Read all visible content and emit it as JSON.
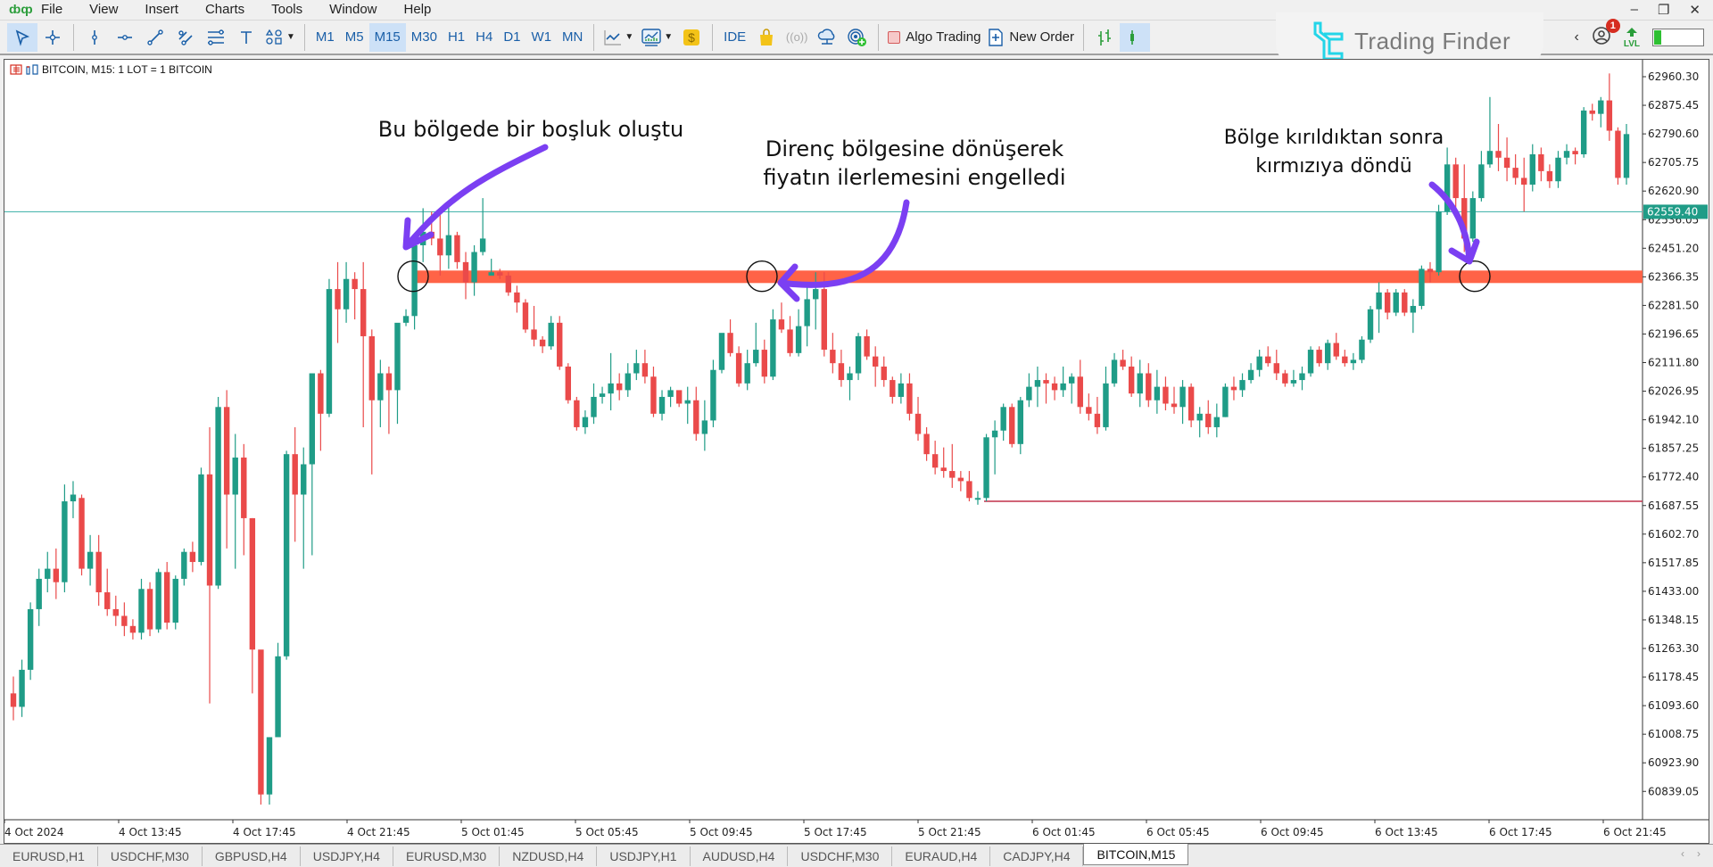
{
  "menu": {
    "items": [
      "File",
      "View",
      "Insert",
      "Charts",
      "Tools",
      "Window",
      "Help"
    ]
  },
  "window_controls": [
    "minimize",
    "restore",
    "close"
  ],
  "toolbar": {
    "drawing_tools": [
      "cursor-icon",
      "crosshair-icon",
      "vertical-line-icon",
      "horizontal-line-icon",
      "trendline-icon",
      "channel-icon",
      "fibonacci-icon",
      "text-icon",
      "shapes-icon"
    ],
    "timeframes": [
      "M1",
      "M5",
      "M15",
      "M30",
      "H1",
      "H4",
      "D1",
      "W1",
      "MN"
    ],
    "active_timeframe": "M15",
    "ide_label": "IDE",
    "algo_trading_label": "Algo Trading",
    "new_order_label": "New Order"
  },
  "brand": {
    "name": "Trading Finder",
    "color": "#23d5e8"
  },
  "notifications": {
    "count": "1"
  },
  "level": {
    "label": "LVL",
    "fill_fraction": 0.15
  },
  "chart": {
    "symbol_info": "BITCOIN, M15:  1 LOT = 1 BITCOIN",
    "current_price_label": "62559.40",
    "colors": {
      "bull": "#1f9c87",
      "bear": "#ea4a4a",
      "zone": "#ff6347",
      "bid_line": "#4fb8b0",
      "support_line": "#c0304a",
      "arrow": "#7b3ff2"
    },
    "annotations": [
      {
        "text": "Bu bölgede bir boşluk oluştu"
      },
      {
        "text_line1": "Direnç bölgesine dönüşerek",
        "text_line2": "fiyatın ilerlemesini engelledi"
      },
      {
        "text_line1": "Bölge kırıldıktan sonra",
        "text_line2": "kırmızıya döndü"
      }
    ]
  },
  "chart_data": {
    "type": "candlestick",
    "title": "BITCOIN, M15",
    "xlabel": "",
    "ylabel": "",
    "y_ticks": [
      "62960.30",
      "62875.45",
      "62790.60",
      "62705.75",
      "62620.90",
      "62536.05",
      "62451.20",
      "62366.35",
      "62281.50",
      "62196.65",
      "62111.80",
      "62026.95",
      "61942.10",
      "61857.25",
      "61772.40",
      "61687.55",
      "61602.70",
      "61517.85",
      "61433.00",
      "61348.15",
      "61263.30",
      "61178.45",
      "61093.60",
      "61008.75",
      "60923.90",
      "60839.05"
    ],
    "ylim": [
      60800,
      63000
    ],
    "x_ticks": [
      "4 Oct 2024",
      "4 Oct 13:45",
      "4 Oct 17:45",
      "4 Oct 21:45",
      "5 Oct 01:45",
      "5 Oct 05:45",
      "5 Oct 09:45",
      "5 Oct 17:45",
      "5 Oct 21:45",
      "6 Oct 01:45",
      "6 Oct 05:45",
      "6 Oct 09:45",
      "6 Oct 13:45",
      "6 Oct 17:45",
      "6 Oct 21:45"
    ],
    "current_price": 62559.4,
    "resistance_zone": [
      62350,
      62385
    ],
    "support_line": 61700,
    "ohlc": [
      [
        61130,
        61180,
        61050,
        61090
      ],
      [
        61090,
        61230,
        61060,
        61200
      ],
      [
        61200,
        61400,
        61170,
        61380
      ],
      [
        61380,
        61500,
        61330,
        61470
      ],
      [
        61470,
        61550,
        61430,
        61500
      ],
      [
        61500,
        61560,
        61410,
        61460
      ],
      [
        61460,
        61750,
        61430,
        61700
      ],
      [
        61700,
        61760,
        61650,
        61720
      ],
      [
        61710,
        61720,
        61480,
        61500
      ],
      [
        61500,
        61600,
        61450,
        61550
      ],
      [
        61550,
        61600,
        61390,
        61430
      ],
      [
        61430,
        61500,
        61360,
        61380
      ],
      [
        61380,
        61420,
        61330,
        61360
      ],
      [
        61360,
        61400,
        61300,
        61330
      ],
      [
        61330,
        61350,
        61290,
        61310
      ],
      [
        61310,
        61470,
        61290,
        61440
      ],
      [
        61440,
        61460,
        61300,
        61320
      ],
      [
        61320,
        61500,
        61310,
        61490
      ],
      [
        61490,
        61520,
        61320,
        61340
      ],
      [
        61340,
        61480,
        61320,
        61470
      ],
      [
        61470,
        61560,
        61450,
        61550
      ],
      [
        61550,
        61580,
        61490,
        61520
      ],
      [
        61520,
        61800,
        61510,
        61780
      ],
      [
        61780,
        61920,
        61100,
        61450
      ],
      [
        61450,
        62010,
        61440,
        61980
      ],
      [
        61980,
        62030,
        61560,
        61720
      ],
      [
        61720,
        61900,
        61500,
        61830
      ],
      [
        61830,
        61870,
        61540,
        61650
      ],
      [
        61650,
        61650,
        61130,
        61260
      ],
      [
        61260,
        61250,
        60800,
        60830
      ],
      [
        60830,
        61000,
        60800,
        61000
      ],
      [
        61000,
        61280,
        61020,
        61240
      ],
      [
        61240,
        61850,
        61230,
        61840
      ],
      [
        61840,
        61920,
        61580,
        61720
      ],
      [
        61720,
        61860,
        61500,
        61810
      ],
      [
        61810,
        62070,
        61540,
        62080
      ],
      [
        62080,
        62090,
        61850,
        61960
      ],
      [
        61960,
        62360,
        61950,
        62330
      ],
      [
        62330,
        62410,
        62170,
        62270
      ],
      [
        62270,
        62410,
        62230,
        62360
      ],
      [
        62360,
        62380,
        62240,
        62330
      ],
      [
        62330,
        62410,
        61920,
        62190
      ],
      [
        62190,
        62210,
        61780,
        62000
      ],
      [
        62000,
        62120,
        61920,
        62080
      ],
      [
        62080,
        62100,
        61900,
        62030
      ],
      [
        62030,
        62210,
        61930,
        62230
      ],
      [
        62230,
        62270,
        62220,
        62250
      ],
      [
        62250,
        62460,
        62210,
        62460
      ],
      [
        62460,
        62570,
        62410,
        62500
      ],
      [
        62500,
        62560,
        62460,
        62480
      ],
      [
        62480,
        62570,
        62370,
        62430
      ],
      [
        62430,
        62580,
        62390,
        62490
      ],
      [
        62490,
        62500,
        62390,
        62410
      ],
      [
        62410,
        62440,
        62300,
        62350
      ],
      [
        62350,
        62460,
        62310,
        62440
      ],
      [
        62440,
        62600,
        62430,
        62480
      ],
      [
        62370,
        62420,
        62370,
        62380
      ],
      [
        62380,
        62390,
        62360,
        62370
      ],
      [
        62370,
        62380,
        62310,
        62320
      ],
      [
        62320,
        62340,
        62260,
        62290
      ],
      [
        62290,
        62300,
        62200,
        62210
      ],
      [
        62210,
        62280,
        62160,
        62180
      ],
      [
        62180,
        62190,
        62140,
        62160
      ],
      [
        62160,
        62250,
        62150,
        62230
      ],
      [
        62230,
        62250,
        62090,
        62100
      ],
      [
        62100,
        62110,
        61990,
        62000
      ],
      [
        62000,
        62010,
        61910,
        61920
      ],
      [
        61920,
        61970,
        61900,
        61950
      ],
      [
        61950,
        62050,
        61930,
        62010
      ],
      [
        62010,
        62040,
        61990,
        62020
      ],
      [
        62020,
        62140,
        61970,
        62050
      ],
      [
        62050,
        62080,
        62000,
        62030
      ],
      [
        62030,
        62110,
        62010,
        62080
      ],
      [
        62080,
        62150,
        62060,
        62110
      ],
      [
        62110,
        62150,
        62050,
        62070
      ],
      [
        62070,
        62100,
        61950,
        61960
      ],
      [
        61960,
        62030,
        61940,
        62010
      ],
      [
        62010,
        62040,
        61980,
        62030
      ],
      [
        62030,
        62020,
        61980,
        61990
      ],
      [
        61990,
        62040,
        61930,
        62000
      ],
      [
        62000,
        62040,
        61880,
        61900
      ],
      [
        61900,
        62000,
        61850,
        61940
      ],
      [
        61940,
        62120,
        61920,
        62090
      ],
      [
        62090,
        62180,
        62080,
        62200
      ],
      [
        62200,
        62240,
        62130,
        62140
      ],
      [
        62140,
        62160,
        62040,
        62050
      ],
      [
        62050,
        62150,
        62030,
        62110
      ],
      [
        62110,
        62230,
        62100,
        62150
      ],
      [
        62150,
        62180,
        62050,
        62070
      ],
      [
        62070,
        62270,
        62060,
        62240
      ],
      [
        62240,
        62290,
        62200,
        62210
      ],
      [
        62210,
        62250,
        62130,
        62140
      ],
      [
        62140,
        62270,
        62130,
        62220
      ],
      [
        62220,
        62350,
        62160,
        62300
      ],
      [
        62300,
        62380,
        62210,
        62330
      ],
      [
        62330,
        62380,
        62130,
        62150
      ],
      [
        62150,
        62200,
        62080,
        62110
      ],
      [
        62110,
        62150,
        62040,
        62060
      ],
      [
        62060,
        62100,
        62000,
        62080
      ],
      [
        62080,
        62200,
        62060,
        62190
      ],
      [
        62190,
        62210,
        62120,
        62130
      ],
      [
        62130,
        62160,
        62040,
        62100
      ],
      [
        62100,
        62130,
        62040,
        62060
      ],
      [
        62060,
        62070,
        61990,
        62010
      ],
      [
        62010,
        62080,
        61990,
        62050
      ],
      [
        62050,
        62080,
        61940,
        61960
      ],
      [
        61960,
        62010,
        61880,
        61900
      ],
      [
        61900,
        61920,
        61820,
        61840
      ],
      [
        61840,
        61880,
        61780,
        61800
      ],
      [
        61800,
        61860,
        61770,
        61790
      ],
      [
        61790,
        61870,
        61740,
        61770
      ],
      [
        61770,
        61790,
        61730,
        61760
      ],
      [
        61760,
        61790,
        61700,
        61710
      ],
      [
        61710,
        61730,
        61690,
        61710
      ],
      [
        61710,
        61900,
        61700,
        61890
      ],
      [
        61890,
        61940,
        61780,
        61910
      ],
      [
        61910,
        61990,
        61880,
        61980
      ],
      [
        61980,
        61990,
        61860,
        61870
      ],
      [
        61870,
        62010,
        61840,
        62000
      ],
      [
        62000,
        62080,
        61980,
        62040
      ],
      [
        62040,
        62100,
        61980,
        62060
      ],
      [
        62060,
        62080,
        61990,
        62050
      ],
      [
        62050,
        62070,
        62000,
        62030
      ],
      [
        62030,
        62100,
        62010,
        62050
      ],
      [
        62050,
        62080,
        61990,
        62070
      ],
      [
        62070,
        62120,
        61960,
        61980
      ],
      [
        61980,
        62020,
        61940,
        61960
      ],
      [
        61960,
        62010,
        61900,
        61920
      ],
      [
        61920,
        62100,
        61910,
        62050
      ],
      [
        62050,
        62140,
        62040,
        62120
      ],
      [
        62120,
        62150,
        62090,
        62100
      ],
      [
        62100,
        62130,
        62010,
        62020
      ],
      [
        62020,
        62120,
        61980,
        62080
      ],
      [
        62080,
        62110,
        61980,
        62000
      ],
      [
        62000,
        62090,
        61960,
        62040
      ],
      [
        62040,
        62070,
        61970,
        61990
      ],
      [
        61990,
        62040,
        61960,
        61980
      ],
      [
        61980,
        62060,
        61930,
        62040
      ],
      [
        62040,
        62050,
        61920,
        61940
      ],
      [
        61940,
        61980,
        61890,
        61960
      ],
      [
        61960,
        62000,
        61900,
        61920
      ],
      [
        61920,
        61990,
        61890,
        61950
      ],
      [
        61950,
        62050,
        61950,
        62040
      ],
      [
        62040,
        62070,
        62000,
        62030
      ],
      [
        62030,
        62080,
        62010,
        62060
      ],
      [
        62060,
        62110,
        62050,
        62090
      ],
      [
        62090,
        62150,
        62070,
        62130
      ],
      [
        62130,
        62160,
        62100,
        62110
      ],
      [
        62110,
        62150,
        62060,
        62080
      ],
      [
        62080,
        62090,
        62040,
        62050
      ],
      [
        62050,
        62090,
        62040,
        62060
      ],
      [
        62060,
        62100,
        62030,
        62080
      ],
      [
        62080,
        62160,
        62070,
        62150
      ],
      [
        62150,
        62160,
        62100,
        62110
      ],
      [
        62110,
        62180,
        62090,
        62170
      ],
      [
        62170,
        62200,
        62120,
        62130
      ],
      [
        62130,
        62150,
        62100,
        62110
      ],
      [
        62110,
        62140,
        62090,
        62120
      ],
      [
        62120,
        62190,
        62110,
        62180
      ],
      [
        62180,
        62280,
        62170,
        62270
      ],
      [
        62270,
        62350,
        62200,
        62320
      ],
      [
        62320,
        62330,
        62240,
        62260
      ],
      [
        62260,
        62330,
        62250,
        62320
      ],
      [
        62320,
        62330,
        62250,
        62260
      ],
      [
        62260,
        62300,
        62200,
        62280
      ],
      [
        62280,
        62400,
        62270,
        62390
      ],
      [
        62390,
        62410,
        62350,
        62380
      ],
      [
        62380,
        62580,
        62370,
        62560
      ],
      [
        62560,
        62750,
        62550,
        62700
      ],
      [
        62700,
        62720,
        62540,
        62600
      ],
      [
        62600,
        62700,
        62440,
        62480
      ],
      [
        62480,
        62620,
        62470,
        62600
      ],
      [
        62600,
        62740,
        62590,
        62700
      ],
      [
        62700,
        62900,
        62690,
        62740
      ],
      [
        62740,
        62820,
        62680,
        62720
      ],
      [
        62720,
        62780,
        62650,
        62690
      ],
      [
        62690,
        62730,
        62640,
        62660
      ],
      [
        62660,
        62720,
        62560,
        62640
      ],
      [
        62640,
        62760,
        62620,
        62730
      ],
      [
        62730,
        62750,
        62650,
        62680
      ],
      [
        62680,
        62700,
        62630,
        62650
      ],
      [
        62650,
        62740,
        62630,
        62720
      ],
      [
        62720,
        62760,
        62700,
        62740
      ],
      [
        62740,
        62750,
        62700,
        62730
      ],
      [
        62730,
        62870,
        62720,
        62860
      ],
      [
        62860,
        62880,
        62830,
        62850
      ],
      [
        62850,
        62900,
        62810,
        62890
      ],
      [
        62890,
        62970,
        62770,
        62800
      ],
      [
        62800,
        62810,
        62640,
        62660
      ],
      [
        62660,
        62820,
        62640,
        62790
      ]
    ]
  },
  "tabs": [
    "EURUSD,H1",
    "USDCHF,M30",
    "GBPUSD,H4",
    "USDJPY,H4",
    "EURUSD,M30",
    "NZDUSD,H4",
    "USDJPY,H1",
    "AUDUSD,H4",
    "USDCHF,M30",
    "EURAUD,H4",
    "CADJPY,H4",
    "BITCOIN,M15"
  ],
  "active_tab": "BITCOIN,M15"
}
